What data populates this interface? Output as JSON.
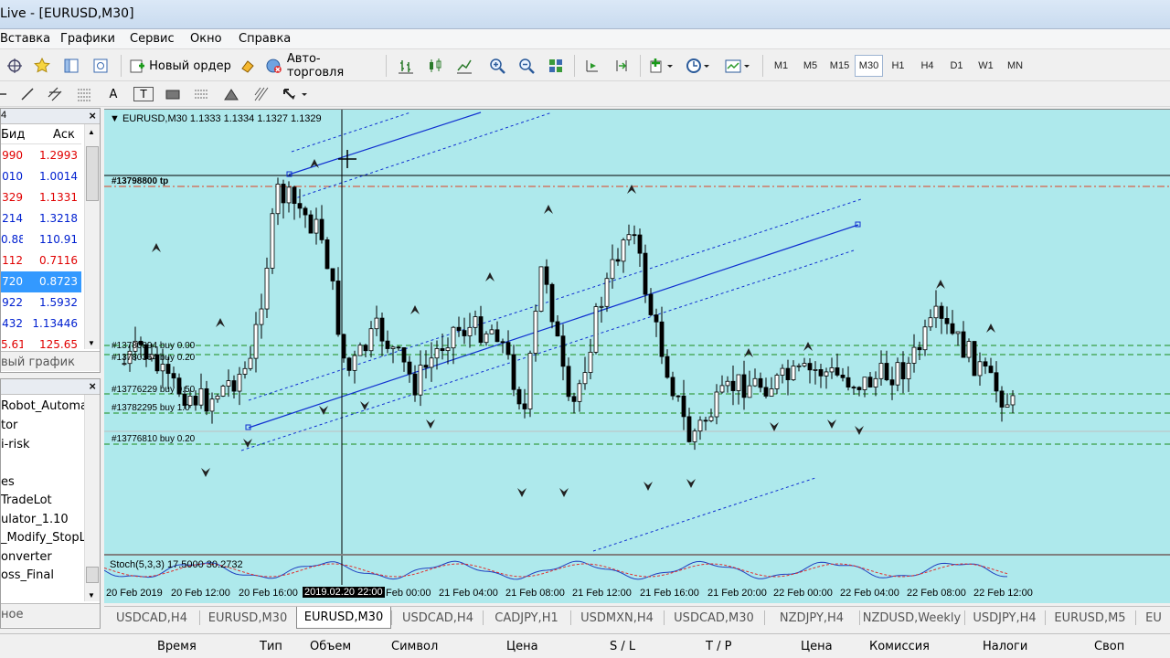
{
  "window": {
    "title": "Live - [EURUSD,M30]"
  },
  "menu": [
    "Вставка",
    "Графики",
    "Сервис",
    "Окно",
    "Справка"
  ],
  "toolbar": {
    "new_order": "Новый ордер",
    "auto_trading": "Авто-торговля",
    "timeframes": [
      "M1",
      "M5",
      "M15",
      "M30",
      "H1",
      "H4",
      "D1",
      "W1",
      "MN"
    ],
    "active_timeframe": "M30",
    "text_tool": "A",
    "label_tool": "T"
  },
  "market_watch": {
    "panel_tag": "4",
    "columns": {
      "bid": "Бид",
      "ask": "Аск"
    },
    "rows": [
      {
        "bid": "990",
        "ask": "1.2993",
        "dir": "down"
      },
      {
        "bid": "010",
        "ask": "1.0014",
        "dir": "up"
      },
      {
        "bid": "329",
        "ask": "1.1331",
        "dir": "down"
      },
      {
        "bid": "214",
        "ask": "1.3218",
        "dir": "up"
      },
      {
        "bid": "0.88",
        "ask": "110.91",
        "dir": "up"
      },
      {
        "bid": "112",
        "ask": "0.7116",
        "dir": "down"
      },
      {
        "bid": "720",
        "ask": "0.8723",
        "dir": "up",
        "selected": true
      },
      {
        "bid": "922",
        "ask": "1.5932",
        "dir": "up"
      },
      {
        "bid": "432",
        "ask": "1.13446",
        "dir": "up"
      },
      {
        "bid": "5.61",
        "ask": "125.65",
        "dir": "down"
      }
    ],
    "new_chart_tab": "вый график"
  },
  "navigator": {
    "items": [
      "Robot_Automa",
      "tor",
      "i-risk",
      "es",
      "TradeLot",
      "ulator_1.10",
      "_Modify_StopL",
      "onverter",
      "oss_Final"
    ],
    "bottom_tab": "ное"
  },
  "chart": {
    "header": "EURUSD,M30  1.1333 1.1334 1.1327 1.1329",
    "order_labels": [
      "#13798800 tp",
      "#13780894 buy 0.00",
      "#13780364 buy 0.20",
      "#13776229 buy 0.50",
      "#13782295 buy 1.0",
      "#13776810 buy 0.20"
    ],
    "indicator": "Stoch(5,3,3) 17.5000 30.2732",
    "time_labels": [
      "20 Feb 2019",
      "20 Feb 12:00",
      "20 Feb 16:00",
      "2019.02.20 22:00",
      "Feb 00:00",
      "21 Feb 04:00",
      "21 Feb 08:00",
      "21 Feb 12:00",
      "21 Feb 16:00",
      "21 Feb 20:00",
      "22 Feb 00:00",
      "22 Feb 04:00",
      "22 Feb 08:00",
      "22 Feb 12:00"
    ],
    "background": "#aee9ec"
  },
  "chart_tabs": [
    "USDCAD,H4",
    "EURUSD,M30",
    "EURUSD,M30",
    "USDCAD,H4",
    "CADJPY,H1",
    "USDMXN,H4",
    "USDCAD,M30",
    "NZDJPY,H4",
    "NZDUSD,Weekly",
    "USDJPY,H4",
    "EURUSD,M5",
    "EU"
  ],
  "active_tab_index": 2,
  "terminal_columns": [
    "Время",
    "Тип",
    "Объем",
    "Символ",
    "Цена",
    "S / L",
    "T / P",
    "Цена",
    "Комиссия",
    "Налоги",
    "Своп"
  ]
}
